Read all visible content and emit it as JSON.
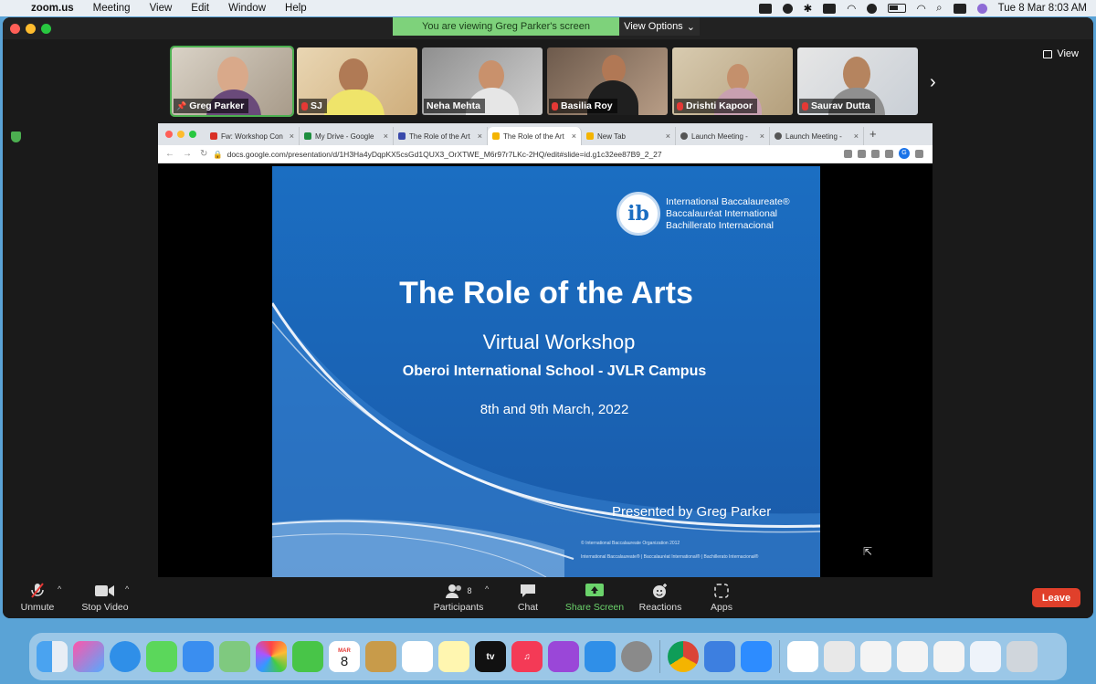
{
  "menubar": {
    "app": "zoom.us",
    "items": [
      "Meeting",
      "View",
      "Edit",
      "Window",
      "Help"
    ],
    "datetime": "Tue 8 Mar  8:03 AM"
  },
  "zoom": {
    "viewing_banner": "You are viewing Greg Parker's screen",
    "view_options": "View Options",
    "view_label": "View",
    "participants": [
      {
        "name": "Greg Parker",
        "muted": false,
        "pinned": true
      },
      {
        "name": "SJ",
        "muted": true
      },
      {
        "name": "Neha Mehta",
        "muted": false
      },
      {
        "name": "Basilia Roy",
        "muted": true
      },
      {
        "name": "Drishti Kapoor",
        "muted": true
      },
      {
        "name": "Saurav Dutta",
        "muted": true
      }
    ],
    "toolbar": {
      "unmute": "Unmute",
      "stop_video": "Stop Video",
      "participants": "Participants",
      "participants_count": "8",
      "chat": "Chat",
      "share_screen": "Share Screen",
      "reactions": "Reactions",
      "apps": "Apps",
      "leave": "Leave"
    }
  },
  "browser": {
    "tabs": [
      {
        "label": "Fw: Workshop Con",
        "favicon_color": "#d93025"
      },
      {
        "label": "My Drive - Google",
        "favicon_color": "#1e8e3e"
      },
      {
        "label": "The Role of the Art",
        "favicon_color": "#3949ab"
      },
      {
        "label": "The Role of the Art",
        "favicon_color": "#f4b400",
        "active": true
      },
      {
        "label": "New Tab",
        "favicon_color": "#f4b400"
      },
      {
        "label": "Launch Meeting -",
        "favicon_color": "#555555"
      },
      {
        "label": "Launch Meeting -",
        "favicon_color": "#555555"
      }
    ],
    "url": "docs.google.com/presentation/d/1H3Ha4yDqpKX5csGd1QUX3_OrXTWE_M6r97r7LKc-2HQ/edit#slide=id.g1c32ee87B9_2_27"
  },
  "slide": {
    "logo_lines": [
      "International Baccalaureate®",
      "Baccalauréat International",
      "Bachillerato Internacional"
    ],
    "logo_mark": "ib",
    "title": "The Role of the Arts",
    "subtitle": "Virtual Workshop",
    "school": "Oberoi International School - JVLR Campus",
    "date": "8th and 9th March, 2022",
    "presenter": "Presented by Greg Parker",
    "copyright": "© International Baccalaureate Organization 2012",
    "footer": "International Baccalaureate®  |  Baccalauréat International®  |  Bachillerato Internacional®"
  },
  "dock": {
    "calendar_month": "MAR",
    "calendar_day": "8",
    "tv_label": "tv"
  },
  "colors": {
    "share_green": "#6bd36b",
    "leave_red": "#e0402b",
    "slide_blue": "#1b6ec2"
  }
}
